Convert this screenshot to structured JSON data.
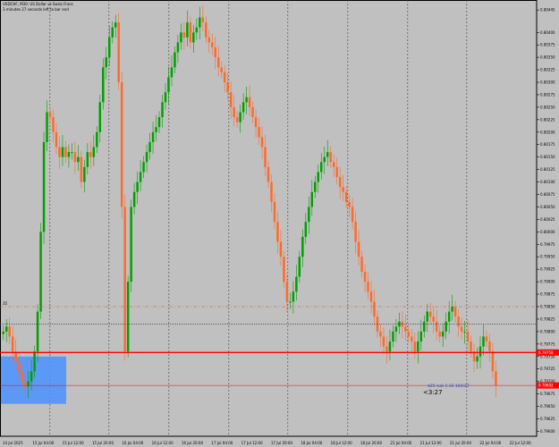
{
  "header": {
    "symbol_line": "USDCHF, M30: US Dollar vs Swiss Franc",
    "timer_line": "3 minutes 27 seconds left to bar end"
  },
  "colors": {
    "background": "#c0c0c0",
    "bull_candle": "#00a000",
    "bear_candle": "#ff6a2a",
    "support_line": "#ff0000",
    "zone_fill": "#4a90ff",
    "grid": "#404040",
    "price_label_bg": "#ff0000"
  },
  "chart_data": {
    "type": "candlestick",
    "y_axis_ticks": [
      "0.80445",
      "0.80400",
      "0.80375",
      "0.80350",
      "0.80325",
      "0.80300",
      "0.80275",
      "0.80250",
      "0.80225",
      "0.80200",
      "0.80175",
      "0.80150",
      "0.80125",
      "0.80100",
      "0.80075",
      "0.80050",
      "0.80025",
      "0.80000",
      "0.79975",
      "0.79950",
      "0.79925",
      "0.79900",
      "0.79875",
      "0.79850",
      "0.79825",
      "0.79800",
      "0.79775",
      "0.79750",
      "0.79725",
      "0.79700",
      "0.79675",
      "0.79650",
      "0.79625",
      "0.79600"
    ],
    "x_axis_ticks": [
      "14 Jul 2025",
      "15 Jul 04:00",
      "15 Jul 12:00",
      "15 Jul 20:00",
      "16 Jul 04:00",
      "16 Jul 12:00",
      "16 Jul 20:00",
      "17 Jul 04:00",
      "17 Jul 12:00",
      "17 Jul 20:00",
      "18 Jul 04:00",
      "18 Jul 12:00",
      "18 Jul 20:00",
      "21 Jul 04:00",
      "21 Jul 12:00",
      "21 Jul 20:00",
      "22 Jul 04:00",
      "22 Jul 12:00"
    ],
    "support_price_label": "0.79758",
    "current_price_label": "0.79692",
    "top_left_marker": "35",
    "tooltip_line": "$25 sub 1.32 183/27",
    "countdown": "<3:27",
    "closes": [
      0.798,
      0.7981,
      0.7979,
      0.7976,
      0.7974,
      0.7972,
      0.797,
      0.7969,
      0.797,
      0.7972,
      0.7976,
      0.7984,
      0.8,
      0.8018,
      0.8024,
      0.8023,
      0.802,
      0.8017,
      0.8015,
      0.8017,
      0.8015,
      0.8016,
      0.8016,
      0.8014,
      0.8015,
      0.801,
      0.8013,
      0.8016,
      0.8015,
      0.8017,
      0.802,
      0.8026,
      0.8033,
      0.8035,
      0.8039,
      0.8041,
      0.8042,
      0.803,
      0.8005,
      0.7976,
      0.799,
      0.8005,
      0.8008,
      0.801,
      0.8012,
      0.8014,
      0.8016,
      0.8018,
      0.802,
      0.8021,
      0.8023,
      0.8026,
      0.8028,
      0.8031,
      0.8033,
      0.8036,
      0.8038,
      0.804,
      0.8039,
      0.8042,
      0.8038,
      0.804,
      0.8041,
      0.8043,
      0.8042,
      0.8039,
      0.8038,
      0.8037,
      0.8035,
      0.8033,
      0.8032,
      0.803,
      0.8028,
      0.8025,
      0.8023,
      0.8022,
      0.8024,
      0.8026,
      0.8027,
      0.8025,
      0.8023,
      0.8021,
      0.8019,
      0.8017,
      0.8013,
      0.801,
      0.8006,
      0.8002,
      0.7998,
      0.7995,
      0.799,
      0.7986,
      0.7986,
      0.7988,
      0.7991,
      0.7995,
      0.7999,
      0.8002,
      0.8005,
      0.8008,
      0.801,
      0.8012,
      0.8014,
      0.8015,
      0.8016,
      0.8014,
      0.8013,
      0.8011,
      0.8009,
      0.8008,
      0.8006,
      0.8005,
      0.8002,
      0.7998,
      0.7995,
      0.7992,
      0.799,
      0.7988,
      0.7986,
      0.7983,
      0.798,
      0.7979,
      0.7977,
      0.7976,
      0.7978,
      0.798,
      0.7981,
      0.7982,
      0.7981,
      0.798,
      0.7979,
      0.7978,
      0.7976,
      0.7978,
      0.798,
      0.7982,
      0.7984,
      0.7983,
      0.7982,
      0.798,
      0.7979,
      0.798,
      0.7982,
      0.7984,
      0.7985,
      0.7983,
      0.7981,
      0.798,
      0.798,
      0.7978,
      0.7976,
      0.7974,
      0.7975,
      0.7977,
      0.7979,
      0.7978,
      0.7976,
      0.7972,
      0.79692
    ]
  }
}
